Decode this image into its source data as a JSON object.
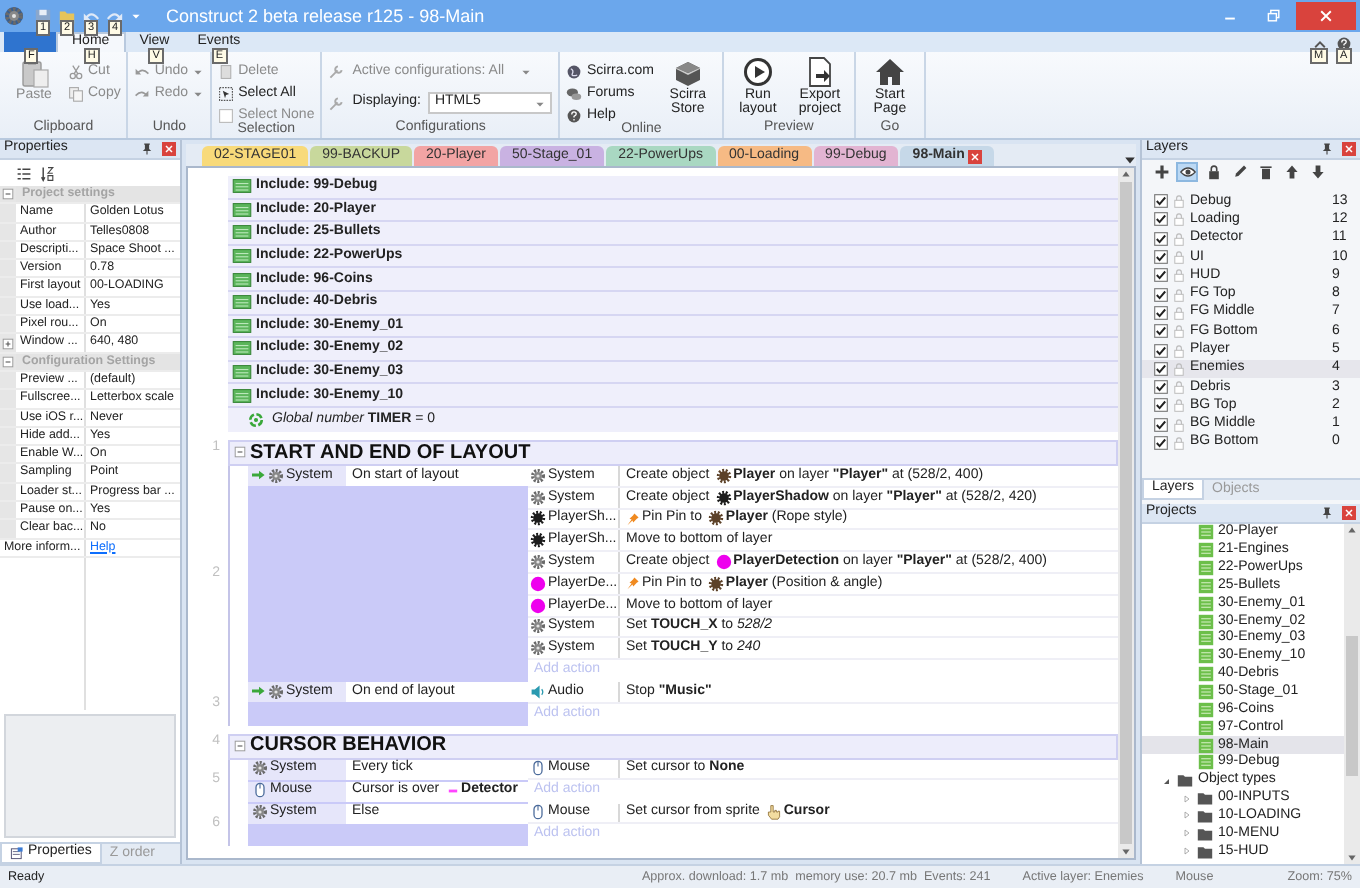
{
  "window": {
    "title": "Construct 2 beta release r125 - 98-Main",
    "quick_access_keytips": [
      "1",
      "2",
      "3",
      "4"
    ]
  },
  "ribbon": {
    "tabs": [
      {
        "kind": "file",
        "keytip": "F",
        "selected": false
      },
      {
        "kind": "tab",
        "label": "Home",
        "keytip": "H",
        "selected": true
      },
      {
        "kind": "tab",
        "label": "View",
        "keytip": "V",
        "selected": false
      },
      {
        "kind": "tab",
        "label": "Events",
        "keytip": "E",
        "selected": false
      }
    ],
    "right_keytips": [
      "M",
      "A"
    ],
    "groups": [
      {
        "label": "Clipboard",
        "items": [
          {
            "kind": "large",
            "label": "Paste",
            "disabled": true
          },
          {
            "kind": "small",
            "label": "Cut",
            "disabled": true
          },
          {
            "kind": "small",
            "label": "Copy",
            "disabled": true
          }
        ]
      },
      {
        "label": "Undo",
        "items": [
          {
            "kind": "split",
            "label": "Undo",
            "disabled": true
          },
          {
            "kind": "split",
            "label": "Redo",
            "disabled": true
          }
        ]
      },
      {
        "label": "Selection",
        "items": [
          {
            "kind": "small",
            "label": "Delete",
            "disabled": true
          },
          {
            "kind": "small",
            "label": "Select All",
            "disabled": false
          },
          {
            "kind": "small",
            "label": "Select None",
            "disabled": true
          }
        ]
      },
      {
        "label": "Configurations",
        "items": [
          {
            "kind": "combo",
            "label": "Active configurations: All",
            "disabled": true
          },
          {
            "kind": "field",
            "label": "Displaying:",
            "value": "HTML5",
            "disabled": false
          }
        ]
      },
      {
        "label": "Online",
        "items": [
          {
            "kind": "small",
            "label": "Scirra.com",
            "disabled": false
          },
          {
            "kind": "small",
            "label": "Forums",
            "disabled": false
          },
          {
            "kind": "small",
            "label": "Help",
            "disabled": false
          },
          {
            "kind": "large",
            "label": "Scirra Store",
            "disabled": false
          }
        ]
      },
      {
        "label": "Preview",
        "items": [
          {
            "kind": "large",
            "label": "Run layout",
            "disabled": false
          },
          {
            "kind": "large",
            "label": "Export project",
            "disabled": false
          }
        ]
      },
      {
        "label": "Go",
        "items": [
          {
            "kind": "large",
            "label": "Start Page",
            "disabled": false
          }
        ]
      }
    ]
  },
  "properties": {
    "title": "Properties",
    "sections": [
      {
        "title": "Project settings",
        "expanded": true,
        "rows": [
          {
            "kind": "plain",
            "name": "Name",
            "value": "Golden Lotus"
          },
          {
            "kind": "plain",
            "name": "Author",
            "value": "Telles0808"
          },
          {
            "kind": "plain",
            "name": "Descripti...",
            "value": "Space Shoot ..."
          },
          {
            "kind": "plain",
            "name": "Version",
            "value": "0.78"
          },
          {
            "kind": "plain",
            "name": "First layout",
            "value": "00-LOADING"
          },
          {
            "kind": "plain",
            "name": "Use load...",
            "value": "Yes"
          },
          {
            "kind": "plain",
            "name": "Pixel rou...",
            "value": "On"
          },
          {
            "kind": "expandable",
            "name": "Window ...",
            "value": "640, 480"
          }
        ]
      },
      {
        "title": "Configuration Settings",
        "expanded": true,
        "rows": [
          {
            "kind": "plain",
            "name": "Preview ...",
            "value": "(default)"
          },
          {
            "kind": "plain",
            "name": "Fullscree...",
            "value": "Letterbox scale"
          },
          {
            "kind": "plain",
            "name": "Use iOS r...",
            "value": "Never"
          },
          {
            "kind": "plain",
            "name": "Hide add...",
            "value": "Yes"
          },
          {
            "kind": "plain",
            "name": "Enable W...",
            "value": "On"
          },
          {
            "kind": "plain",
            "name": "Sampling",
            "value": "Point"
          },
          {
            "kind": "plain",
            "name": "Loader st...",
            "value": "Progress bar ..."
          },
          {
            "kind": "plain",
            "name": "Pause on...",
            "value": "Yes"
          },
          {
            "kind": "plain",
            "name": "Clear bac...",
            "value": "No"
          }
        ]
      }
    ],
    "more_info": {
      "name": "More inform...",
      "link": "Help"
    },
    "tabs": [
      {
        "label": "Properties",
        "selected": true
      },
      {
        "label": "Z order",
        "selected": false
      }
    ]
  },
  "event_sheet": {
    "tabs": [
      {
        "label": "02-STAGE01",
        "color": "#f8da7a",
        "selected": false
      },
      {
        "label": "99-BACKUP",
        "color": "#c8d89c",
        "selected": false
      },
      {
        "label": "20-Player",
        "color": "#f2a4a4",
        "selected": false
      },
      {
        "label": "50-Stage_01",
        "color": "#c9b2e2",
        "selected": false
      },
      {
        "label": "22-PowerUps",
        "color": "#a9d8c2",
        "selected": false
      },
      {
        "label": "00-Loading",
        "color": "#f6ba84",
        "selected": false
      },
      {
        "label": "99-Debug",
        "color": "#e2b4d2",
        "selected": false
      },
      {
        "label": "98-Main",
        "color": "#c6d8e8",
        "selected": true
      }
    ],
    "includes": [
      "Include: 99-Debug",
      "Include: 20-Player",
      "Include: 25-Bullets",
      "Include: 22-PowerUps",
      "Include: 96-Coins",
      "Include: 40-Debris",
      "Include: 30-Enemy_01",
      "Include: 30-Enemy_02",
      "Include: 30-Enemy_03",
      "Include: 30-Enemy_10"
    ],
    "global_variable": "*Global number* **TIMER** = 0",
    "groups": [
      {
        "number": "1",
        "title": "START AND END OF LAYOUT",
        "expanded": true,
        "events": [
          {
            "number": "2",
            "trigger": true,
            "conditions": [
              {
                "object": "System",
                "kind": "system",
                "parts": [
                  {
                    "kind": "text",
                    "text": "On start of layout"
                  }
                ]
              }
            ],
            "actions": [
              {
                "object": "System",
                "kind": "system",
                "parts": [
                  {
                    "kind": "text",
                    "text": "Create object "
                  },
                  {
                    "kind": "sprite",
                    "color": "#5c4128"
                  },
                  {
                    "kind": "text",
                    "text": "**Player** on layer **\"Player\"** at (528/2, 400)"
                  }
                ]
              },
              {
                "object": "System",
                "kind": "system",
                "parts": [
                  {
                    "kind": "text",
                    "text": "Create object "
                  },
                  {
                    "kind": "sprite",
                    "color": "#1c1c1c"
                  },
                  {
                    "kind": "text",
                    "text": "**PlayerShadow** on layer **\"Player\"** at (528/2, 420)"
                  }
                ]
              },
              {
                "object": "PlayerSh...",
                "kind": "sprite",
                "color": "#1c1c1c",
                "parts": [
                  {
                    "kind": "pin"
                  },
                  {
                    "kind": "text",
                    "text": "Pin Pin to "
                  },
                  {
                    "kind": "sprite",
                    "color": "#5c4128"
                  },
                  {
                    "kind": "text",
                    "text": "**Player** (Rope style)"
                  }
                ]
              },
              {
                "object": "PlayerSh...",
                "kind": "sprite",
                "color": "#1c1c1c",
                "parts": [
                  {
                    "kind": "text",
                    "text": "Move to bottom of layer"
                  }
                ]
              },
              {
                "object": "System",
                "kind": "system",
                "parts": [
                  {
                    "kind": "text",
                    "text": "Create object "
                  },
                  {
                    "kind": "dot",
                    "color": "#ee00ee"
                  },
                  {
                    "kind": "text",
                    "text": "**PlayerDetection** on layer **\"Player\"** at (528/2, 400)"
                  }
                ]
              },
              {
                "object": "PlayerDe...",
                "kind": "dot",
                "color": "#ee00ee",
                "parts": [
                  {
                    "kind": "pin"
                  },
                  {
                    "kind": "text",
                    "text": "Pin Pin to "
                  },
                  {
                    "kind": "sprite",
                    "color": "#5c4128"
                  },
                  {
                    "kind": "text",
                    "text": "**Player** (Position & angle)"
                  }
                ]
              },
              {
                "object": "PlayerDe...",
                "kind": "dot",
                "color": "#ee00ee",
                "parts": [
                  {
                    "kind": "text",
                    "text": "Move to bottom of layer"
                  }
                ]
              },
              {
                "object": "System",
                "kind": "system",
                "parts": [
                  {
                    "kind": "text",
                    "text": "Set **TOUCH_X** to *528/2*"
                  }
                ]
              },
              {
                "object": "System",
                "kind": "system",
                "parts": [
                  {
                    "kind": "text",
                    "text": "Set **TOUCH_Y** to *240*"
                  }
                ]
              }
            ],
            "add_action": "Add action"
          },
          {
            "number": "3",
            "trigger": true,
            "conditions": [
              {
                "object": "System",
                "kind": "system",
                "parts": [
                  {
                    "kind": "text",
                    "text": "On end of layout"
                  }
                ]
              }
            ],
            "actions": [
              {
                "object": "Audio",
                "kind": "audio",
                "parts": [
                  {
                    "kind": "text",
                    "text": "Stop **\"Music\"**"
                  }
                ]
              }
            ],
            "add_action": "Add action"
          }
        ]
      },
      {
        "number": "4",
        "title": "CURSOR BEHAVIOR",
        "expanded": true,
        "events": [
          {
            "number": "5",
            "trigger": false,
            "conditions": [
              {
                "object": "System",
                "kind": "system",
                "parts": [
                  {
                    "kind": "text",
                    "text": "Every tick"
                  }
                ]
              },
              {
                "object": "Mouse",
                "kind": "mouse",
                "parts": [
                  {
                    "kind": "text",
                    "text": "Cursor is over "
                  },
                  {
                    "kind": "dash",
                    "color": "#ff44ff"
                  },
                  {
                    "kind": "text",
                    "text": "**Detector**"
                  }
                ]
              }
            ],
            "actions": [
              {
                "object": "Mouse",
                "kind": "mouse",
                "parts": [
                  {
                    "kind": "text",
                    "text": "Set cursor to **None**"
                  }
                ]
              }
            ],
            "add_action": "Add action"
          },
          {
            "number": "6",
            "trigger": false,
            "conditions": [
              {
                "object": "System",
                "kind": "system",
                "parts": [
                  {
                    "kind": "text",
                    "text": "Else"
                  }
                ]
              }
            ],
            "actions": [
              {
                "object": "Mouse",
                "kind": "mouse",
                "parts": [
                  {
                    "kind": "text",
                    "text": "Set cursor from sprite "
                  },
                  {
                    "kind": "cursor"
                  },
                  {
                    "kind": "text",
                    "text": "**Cursor**"
                  }
                ]
              }
            ],
            "add_action": "Add action"
          }
        ]
      }
    ]
  },
  "layers": {
    "title": "Layers",
    "toolbar": [
      {
        "selected": false
      },
      {
        "selected": true
      },
      {
        "selected": false
      },
      {
        "selected": false
      },
      {
        "selected": false
      },
      {
        "selected": false
      },
      {
        "selected": false
      }
    ],
    "items": [
      {
        "name": "Debug",
        "number": "13",
        "visible": true,
        "selected": false
      },
      {
        "name": "Loading",
        "number": "12",
        "visible": true,
        "selected": false
      },
      {
        "name": "Detector",
        "number": "11",
        "visible": true,
        "selected": false
      },
      {
        "name": "UI",
        "number": "10",
        "visible": true,
        "selected": false
      },
      {
        "name": "HUD",
        "number": "9",
        "visible": true,
        "selected": false
      },
      {
        "name": "FG Top",
        "number": "8",
        "visible": true,
        "selected": false
      },
      {
        "name": "FG Middle",
        "number": "7",
        "visible": true,
        "selected": false
      },
      {
        "name": "FG Bottom",
        "number": "6",
        "visible": true,
        "selected": false
      },
      {
        "name": "Player",
        "number": "5",
        "visible": true,
        "selected": false
      },
      {
        "name": "Enemies",
        "number": "4",
        "visible": true,
        "selected": true
      },
      {
        "name": "Debris",
        "number": "3",
        "visible": true,
        "selected": false
      },
      {
        "name": "BG Top",
        "number": "2",
        "visible": true,
        "selected": false
      },
      {
        "name": "BG Middle",
        "number": "1",
        "visible": true,
        "selected": false
      },
      {
        "name": "BG Bottom",
        "number": "0",
        "visible": true,
        "selected": false
      }
    ],
    "tabs": [
      {
        "label": "Layers",
        "selected": true
      },
      {
        "label": "Objects",
        "selected": false
      }
    ]
  },
  "projects": {
    "title": "Projects",
    "event_sheets": [
      {
        "label": "20-Player",
        "selected": false
      },
      {
        "label": "21-Engines",
        "selected": false
      },
      {
        "label": "22-PowerUps",
        "selected": false
      },
      {
        "label": "25-Bullets",
        "selected": false
      },
      {
        "label": "30-Enemy_01",
        "selected": false
      },
      {
        "label": "30-Enemy_02",
        "selected": false
      },
      {
        "label": "30-Enemy_03",
        "selected": false
      },
      {
        "label": "30-Enemy_10",
        "selected": false
      },
      {
        "label": "40-Debris",
        "selected": false
      },
      {
        "label": "50-Stage_01",
        "selected": false
      },
      {
        "label": "96-Coins",
        "selected": false
      },
      {
        "label": "97-Control",
        "selected": false
      },
      {
        "label": "98-Main",
        "selected": true
      },
      {
        "label": "99-Debug",
        "selected": false
      }
    ],
    "folders": [
      {
        "label": "Object types",
        "expanded": true,
        "children": [
          {
            "label": "00-INPUTS",
            "expanded": false
          },
          {
            "label": "10-LOADING",
            "expanded": false
          },
          {
            "label": "10-MENU",
            "expanded": false
          },
          {
            "label": "15-HUD",
            "expanded": false
          }
        ]
      }
    ]
  },
  "status_bar": {
    "message": "Ready",
    "stats": "Approx. download: 1.7 mb  memory use: 20.7 mb  Events: 241",
    "active_layer": "Active layer: Enemies",
    "object": "Mouse",
    "zoom": "Zoom: 75%"
  }
}
